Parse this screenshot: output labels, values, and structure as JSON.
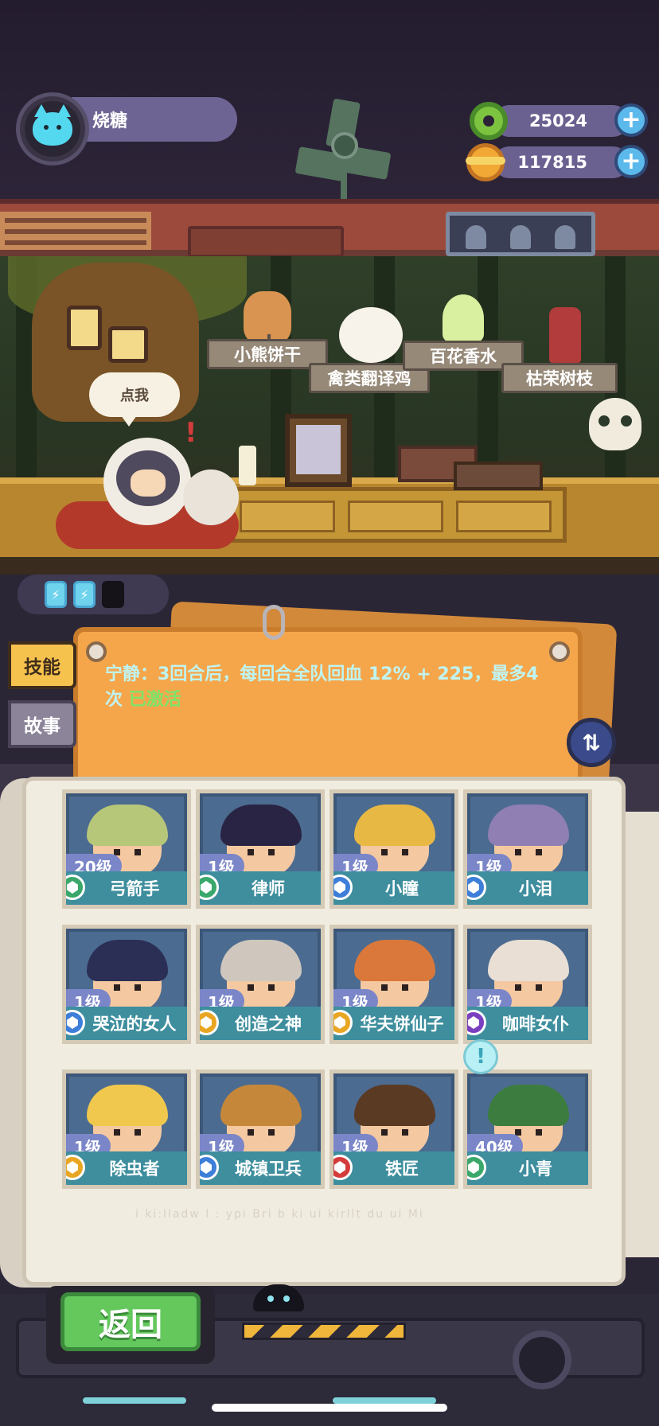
{
  "player": {
    "name": "烧糖",
    "avatar_icon": "cat-face-icon"
  },
  "currencies": [
    {
      "icon": "green-donut-coin-icon",
      "value": "25024",
      "add_label": "+"
    },
    {
      "icon": "planet-coin-icon",
      "value": "117815",
      "add_label": "+"
    }
  ],
  "scene": {
    "speech_bubble": "点我",
    "items": [
      {
        "label": "小熊饼干",
        "icon": "teddy-bear-icon"
      },
      {
        "label": "禽类翻译鸡",
        "icon": "white-chick-icon"
      },
      {
        "label": "百花香水",
        "icon": "flower-perfume-icon"
      },
      {
        "label": "枯荣树枝",
        "icon": "withered-branch-icon"
      }
    ]
  },
  "energy": {
    "cells": [
      {
        "state": "full",
        "icon": "lightning-icon"
      },
      {
        "state": "full",
        "icon": "lightning-icon"
      },
      {
        "state": "empty",
        "icon": ""
      }
    ]
  },
  "tabs": {
    "skill": "技能",
    "story": "故事",
    "active": "skill"
  },
  "skill": {
    "description": "宁静：3回合后，每回合全队回血 12% + 225，最多4次",
    "status": "已激活"
  },
  "swap_icon": "swap-arrows-icon",
  "characters": [
    {
      "level": "20级",
      "name": "弓箭手",
      "rarity_color": "#3aa76b",
      "hair": "#b7c77a"
    },
    {
      "level": "1级",
      "name": "律师",
      "rarity_color": "#3aa76b",
      "hair": "#2a2444"
    },
    {
      "level": "1级",
      "name": "小瞳",
      "rarity_color": "#3d7ed8",
      "hair": "#e8b844"
    },
    {
      "level": "1级",
      "name": "小泪",
      "rarity_color": "#3d7ed8",
      "hair": "#8f7fb3"
    },
    {
      "level": "1级",
      "name": "哭泣的女人",
      "rarity_color": "#3d7ed8",
      "hair": "#2b2e55"
    },
    {
      "level": "1级",
      "name": "创造之神",
      "rarity_color": "#e8a623",
      "hair": "#cfc7bd"
    },
    {
      "level": "1级",
      "name": "华夫饼仙子",
      "rarity_color": "#e8a623",
      "hair": "#d9783a"
    },
    {
      "level": "1级",
      "name": "咖啡女仆",
      "rarity_color": "#7a3fbf",
      "hair": "#e9dfd5"
    },
    {
      "level": "1级",
      "name": "除虫者",
      "rarity_color": "#e8a623",
      "hair": "#f0c84e"
    },
    {
      "level": "1级",
      "name": "城镇卫兵",
      "rarity_color": "#3d7ed8",
      "hair": "#c5873a"
    },
    {
      "level": "1级",
      "name": "铁匠",
      "rarity_color": "#d43b3b",
      "hair": "#5b3a24"
    },
    {
      "level": "40级",
      "name": "小青",
      "rarity_color": "#3aa76b",
      "hair": "#3c7d3f"
    }
  ],
  "notify_badge": "!",
  "blurred_footer": "i ki:lladw l : ypi   Bri b  ki ui kirllt du ui   Mi",
  "back_button": "返回"
}
